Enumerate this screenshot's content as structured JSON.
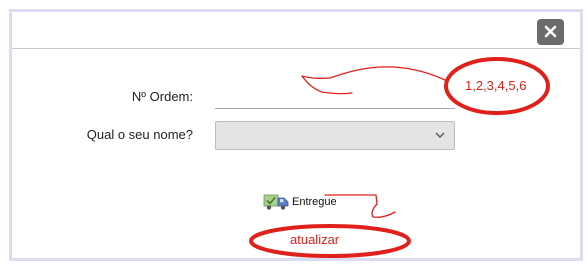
{
  "dialog": {
    "close_icon": "close-icon"
  },
  "form": {
    "order_label": "Nº Ordem:",
    "order_value": "",
    "name_label": "Qual o seu nome?",
    "name_selected": ""
  },
  "actions": {
    "delivered_label": "Entregue",
    "delivered_icon": "delivery-truck-check-icon"
  },
  "annotations": {
    "numbers_text": "1,2,3,4,5,6",
    "update_text": "atualizar",
    "color": "#e0201a"
  }
}
